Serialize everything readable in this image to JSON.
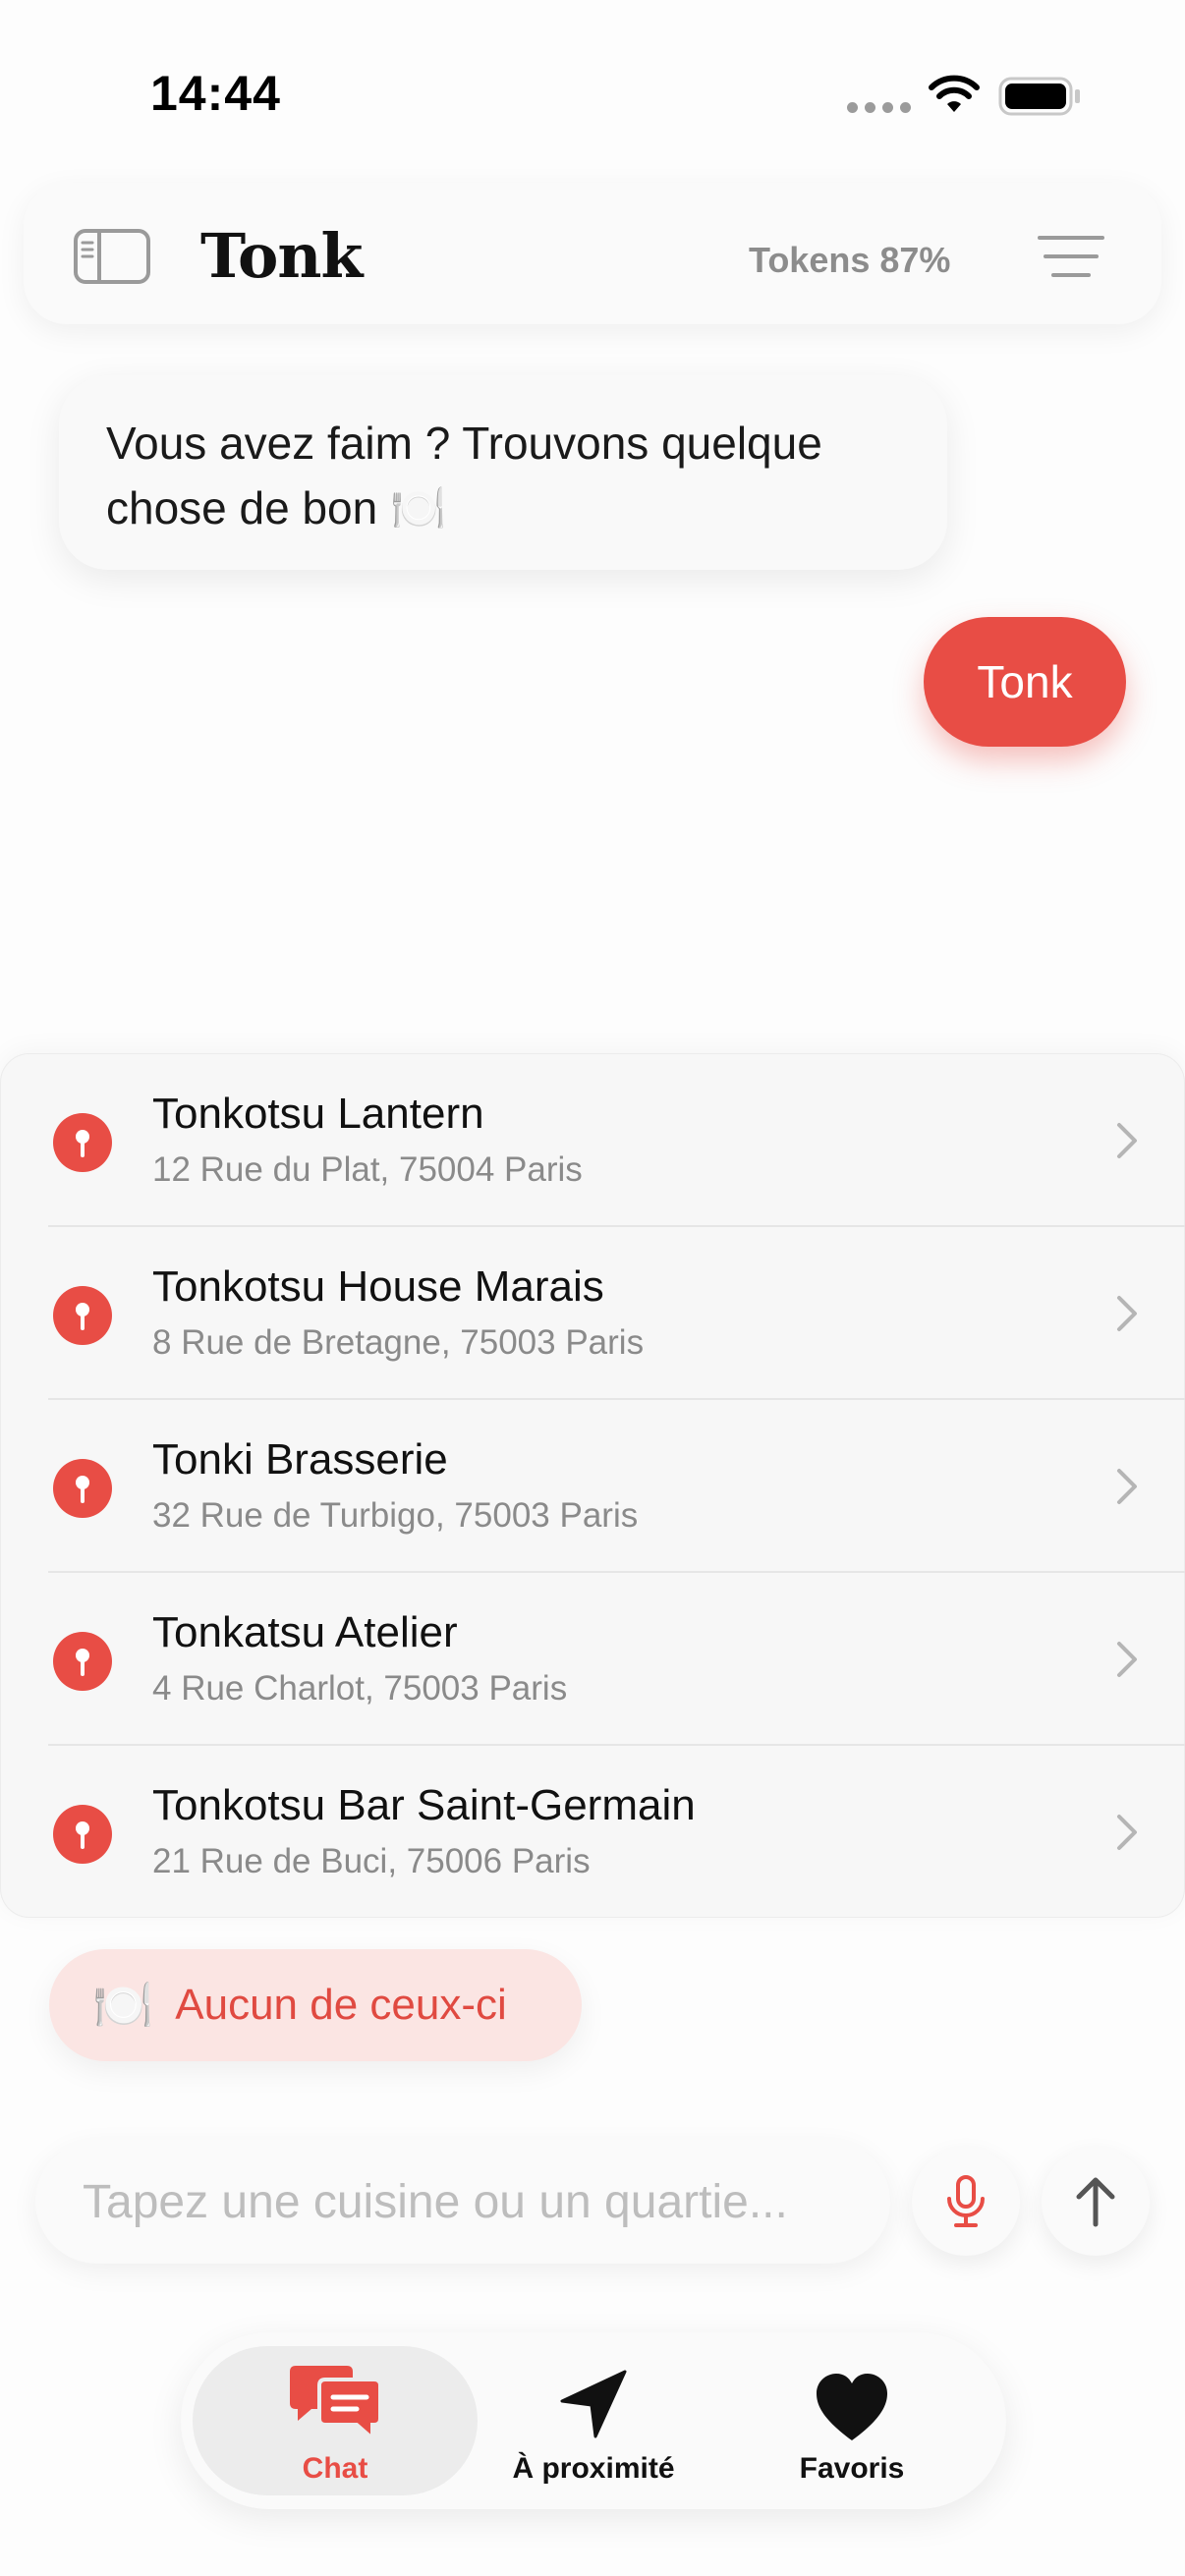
{
  "status_bar": {
    "time": "14:44"
  },
  "header": {
    "title": "Tonk",
    "tokens": "Tokens 87%"
  },
  "messages": {
    "bot_line1": "Vous avez faim ? Trouvons quelque",
    "bot_line2": "chose de bon 🍽️",
    "user": "Tonk"
  },
  "results": [
    {
      "name": "Tonkotsu Lantern",
      "address": "12 Rue du Plat, 75004 Paris"
    },
    {
      "name": "Tonkotsu House Marais",
      "address": "8 Rue de Bretagne, 75003 Paris"
    },
    {
      "name": "Tonki Brasserie",
      "address": "32 Rue de Turbigo, 75003 Paris"
    },
    {
      "name": "Tonkatsu Atelier",
      "address": "4 Rue Charlot, 75003 Paris"
    },
    {
      "name": "Tonkotsu Bar Saint-Germain",
      "address": "21 Rue de Buci, 75006 Paris"
    }
  ],
  "none_button": {
    "emoji": "🍽️",
    "label": "Aucun de ceux-ci"
  },
  "input": {
    "placeholder": "Tapez une cuisine ou un quartie...",
    "value": ""
  },
  "tabs": [
    {
      "label": "Chat",
      "icon": "chat-bubbles-icon",
      "active": true
    },
    {
      "label": "À proximité",
      "icon": "location-arrow-icon",
      "active": false
    },
    {
      "label": "Favoris",
      "icon": "heart-icon",
      "active": false
    }
  ],
  "colors": {
    "accent": "#e84d45",
    "accent_soft": "#fbe5e3",
    "muted_text": "#8a8a8a"
  }
}
